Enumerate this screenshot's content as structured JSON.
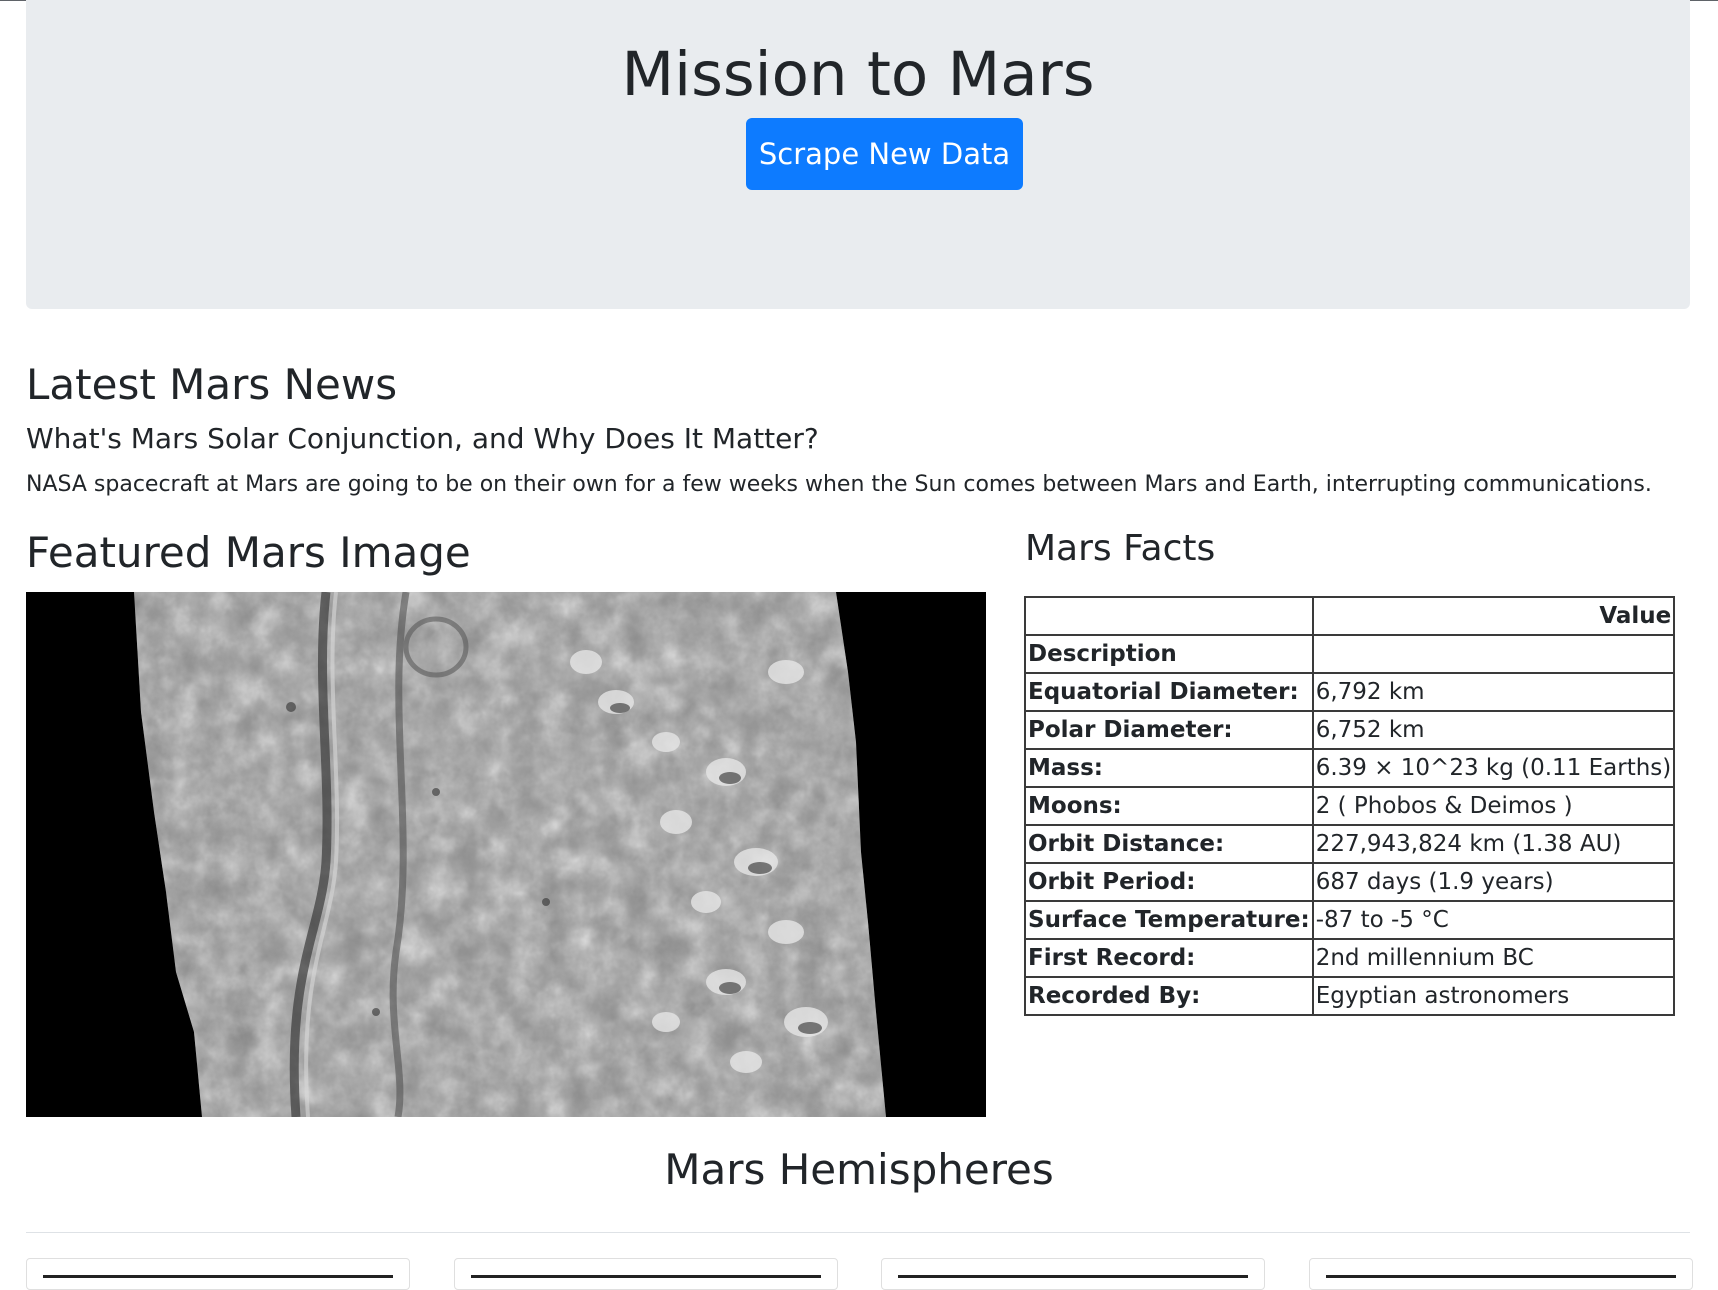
{
  "header": {
    "title": "Mission to Mars",
    "scrape_button": "Scrape New Data"
  },
  "news": {
    "section_title": "Latest Mars News",
    "headline": "What's Mars Solar Conjunction, and Why Does It Matter?",
    "teaser": "NASA spacecraft at Mars are going to be on their own for a few weeks when the Sun comes between Mars and Earth, interrupting communications."
  },
  "featured": {
    "section_title": "Featured Mars Image"
  },
  "facts": {
    "section_title": "Mars Facts",
    "column_header": "Value",
    "rows": [
      {
        "key": "Description",
        "value": ""
      },
      {
        "key": "Equatorial Diameter:",
        "value": "6,792 km"
      },
      {
        "key": "Polar Diameter:",
        "value": "6,752 km"
      },
      {
        "key": "Mass:",
        "value": "6.39 × 10^23 kg (0.11 Earths)"
      },
      {
        "key": "Moons:",
        "value": "2 ( Phobos & Deimos )"
      },
      {
        "key": "Orbit Distance:",
        "value": "227,943,824 km (1.38 AU)"
      },
      {
        "key": "Orbit Period:",
        "value": "687 days (1.9 years)"
      },
      {
        "key": "Surface Temperature:",
        "value": "-87 to -5 °C"
      },
      {
        "key": "First Record:",
        "value": "2nd millennium BC"
      },
      {
        "key": "Recorded By:",
        "value": "Egyptian astronomers"
      }
    ]
  },
  "hemispheres": {
    "section_title": "Mars Hemispheres"
  }
}
